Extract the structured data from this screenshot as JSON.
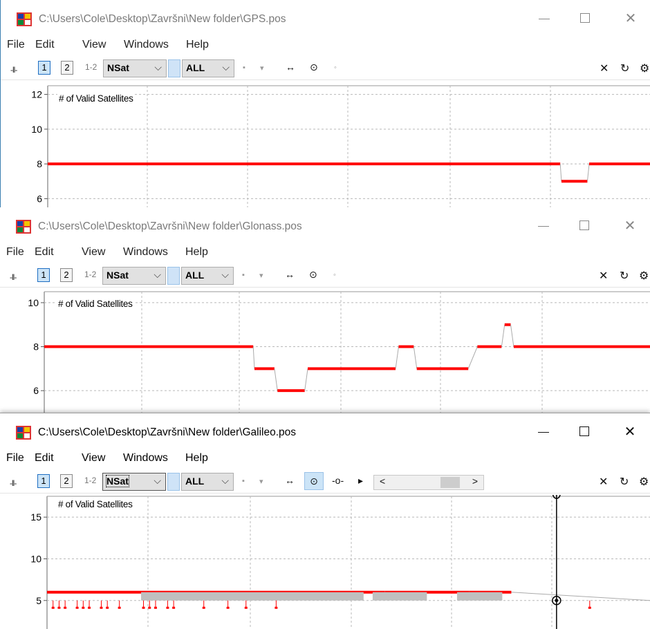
{
  "windows": [
    {
      "title": "C:\\Users\\Cole\\Desktop\\Završni\\New folder\\GPS.pos",
      "toolbar": {
        "plot_type": "NSat",
        "filter": "ALL"
      },
      "plot_label": "# of Valid Satellites",
      "y_ticks": [
        "12",
        "10",
        "8",
        "6"
      ]
    },
    {
      "title": "C:\\Users\\Cole\\Desktop\\Završni\\New folder\\Glonass.pos",
      "toolbar": {
        "plot_type": "NSat",
        "filter": "ALL"
      },
      "plot_label": "# of Valid Satellites",
      "y_ticks": [
        "10",
        "8",
        "6"
      ]
    },
    {
      "title": "C:\\Users\\Cole\\Desktop\\Završni\\New folder\\Galileo.pos",
      "toolbar": {
        "plot_type": "NSat",
        "filter": "ALL"
      },
      "plot_label": "# of Valid Satellites",
      "y_ticks": [
        "15",
        "10",
        "5"
      ]
    }
  ],
  "menu": [
    "File",
    "Edit",
    "View",
    "Windows",
    "Help"
  ],
  "toolbar_labels": {
    "grip": "-ll-",
    "btn1": "1",
    "btn2": "2",
    "btn12": "1-2"
  },
  "icons": {
    "app": "rtkplot-app-icon",
    "minimize": "minimize-icon",
    "maximize": "maximize-icon",
    "close": "close-icon",
    "fit": "fit-horizontal-icon",
    "center": "center-target-icon",
    "point": "point-icon",
    "play": "play-icon",
    "clear": "clear-x-icon",
    "reload": "reload-icon",
    "options": "gear-icon"
  },
  "colors": {
    "series": "#ff0000",
    "gap_fill": "#bfbfbf",
    "active_button": "#cce4f7",
    "grid": "#b8b8b8"
  },
  "chart_data": [
    {
      "type": "line",
      "title": "# of Valid Satellites",
      "ylim": [
        5.5,
        12.5
      ],
      "yticks": [
        12,
        10,
        8,
        6
      ],
      "grid": true,
      "series": [
        {
          "x": [
            0,
            0.85,
            0.852,
            0.895,
            0.898,
            1.0
          ],
          "y": [
            8,
            8,
            7,
            7,
            8,
            8
          ]
        }
      ]
    },
    {
      "type": "line",
      "title": "# of Valid Satellites",
      "ylim": [
        5.0,
        10.5
      ],
      "yticks": [
        10,
        8,
        6
      ],
      "grid": true,
      "series": [
        {
          "x": [
            0,
            0.345,
            0.347,
            0.38,
            0.385,
            0.43,
            0.435,
            0.58,
            0.585,
            0.61,
            0.615,
            0.7,
            0.715,
            0.755,
            0.76,
            0.77,
            0.775,
            1.0
          ],
          "y": [
            8,
            8,
            7,
            7,
            6,
            6,
            7,
            7,
            8,
            8,
            7,
            7,
            8,
            8,
            9,
            9,
            8,
            8
          ]
        }
      ]
    },
    {
      "type": "line",
      "title": "# of Valid Satellites",
      "ylim": [
        1.5,
        17.5
      ],
      "yticks": [
        15,
        10,
        5
      ],
      "grid": true,
      "cursor_x": 0.845,
      "series": [
        {
          "x": [
            0,
            0.56,
            0.7,
            0.77,
            1.0
          ],
          "y": [
            6,
            6,
            6,
            6,
            5
          ]
        }
      ]
    }
  ]
}
